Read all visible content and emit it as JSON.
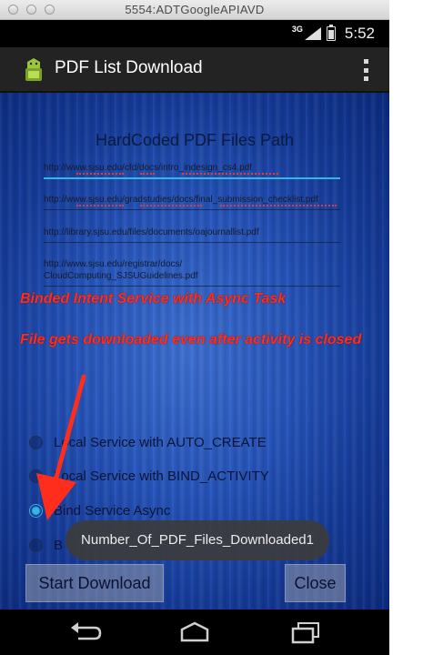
{
  "window": {
    "title": "5554:ADTGoogleAPIAVD"
  },
  "statusbar": {
    "network": "3G",
    "time": "5:52"
  },
  "actionbar": {
    "title": "PDF List Download",
    "menu_icon": "overflow-menu-icon"
  },
  "content": {
    "header": "HardCoded PDF Files Path",
    "urls": [
      "http://www.sjsu.edu/cfd/docs/intro_indesign_cs4.pdf",
      "http://www.sjsu.edu/gradstudies/docs/final_submission_checklist.pdf",
      "http://library.sjsu.edu/files/documents/oajournallist.pdf",
      "http://www.sjsu.edu/registrar/docs/",
      "CloudComputing_SJSUGuidelines.pdf"
    ],
    "annotation_1": "Binded Intent Service with Async Task",
    "annotation_2": "File gets downloaded even after activity is closed",
    "radio_options": [
      {
        "label": "Local Service with AUTO_CREATE",
        "checked": false
      },
      {
        "label": "Local Service with BIND_ACTIVITY",
        "checked": false
      },
      {
        "label": "Bind Service Async",
        "checked": true
      },
      {
        "label": "B",
        "checked": false
      }
    ],
    "toast": "Number_Of_PDF_Files_Downloaded1",
    "buttons": {
      "start": "Start Download",
      "close": "Close"
    }
  },
  "navbar": {
    "icons": [
      "back-icon",
      "home-icon",
      "recent-apps-icon"
    ]
  },
  "colors": {
    "accent": "#33b5e5",
    "annotation": "#ff2d1c",
    "actionbar": "#232323"
  }
}
